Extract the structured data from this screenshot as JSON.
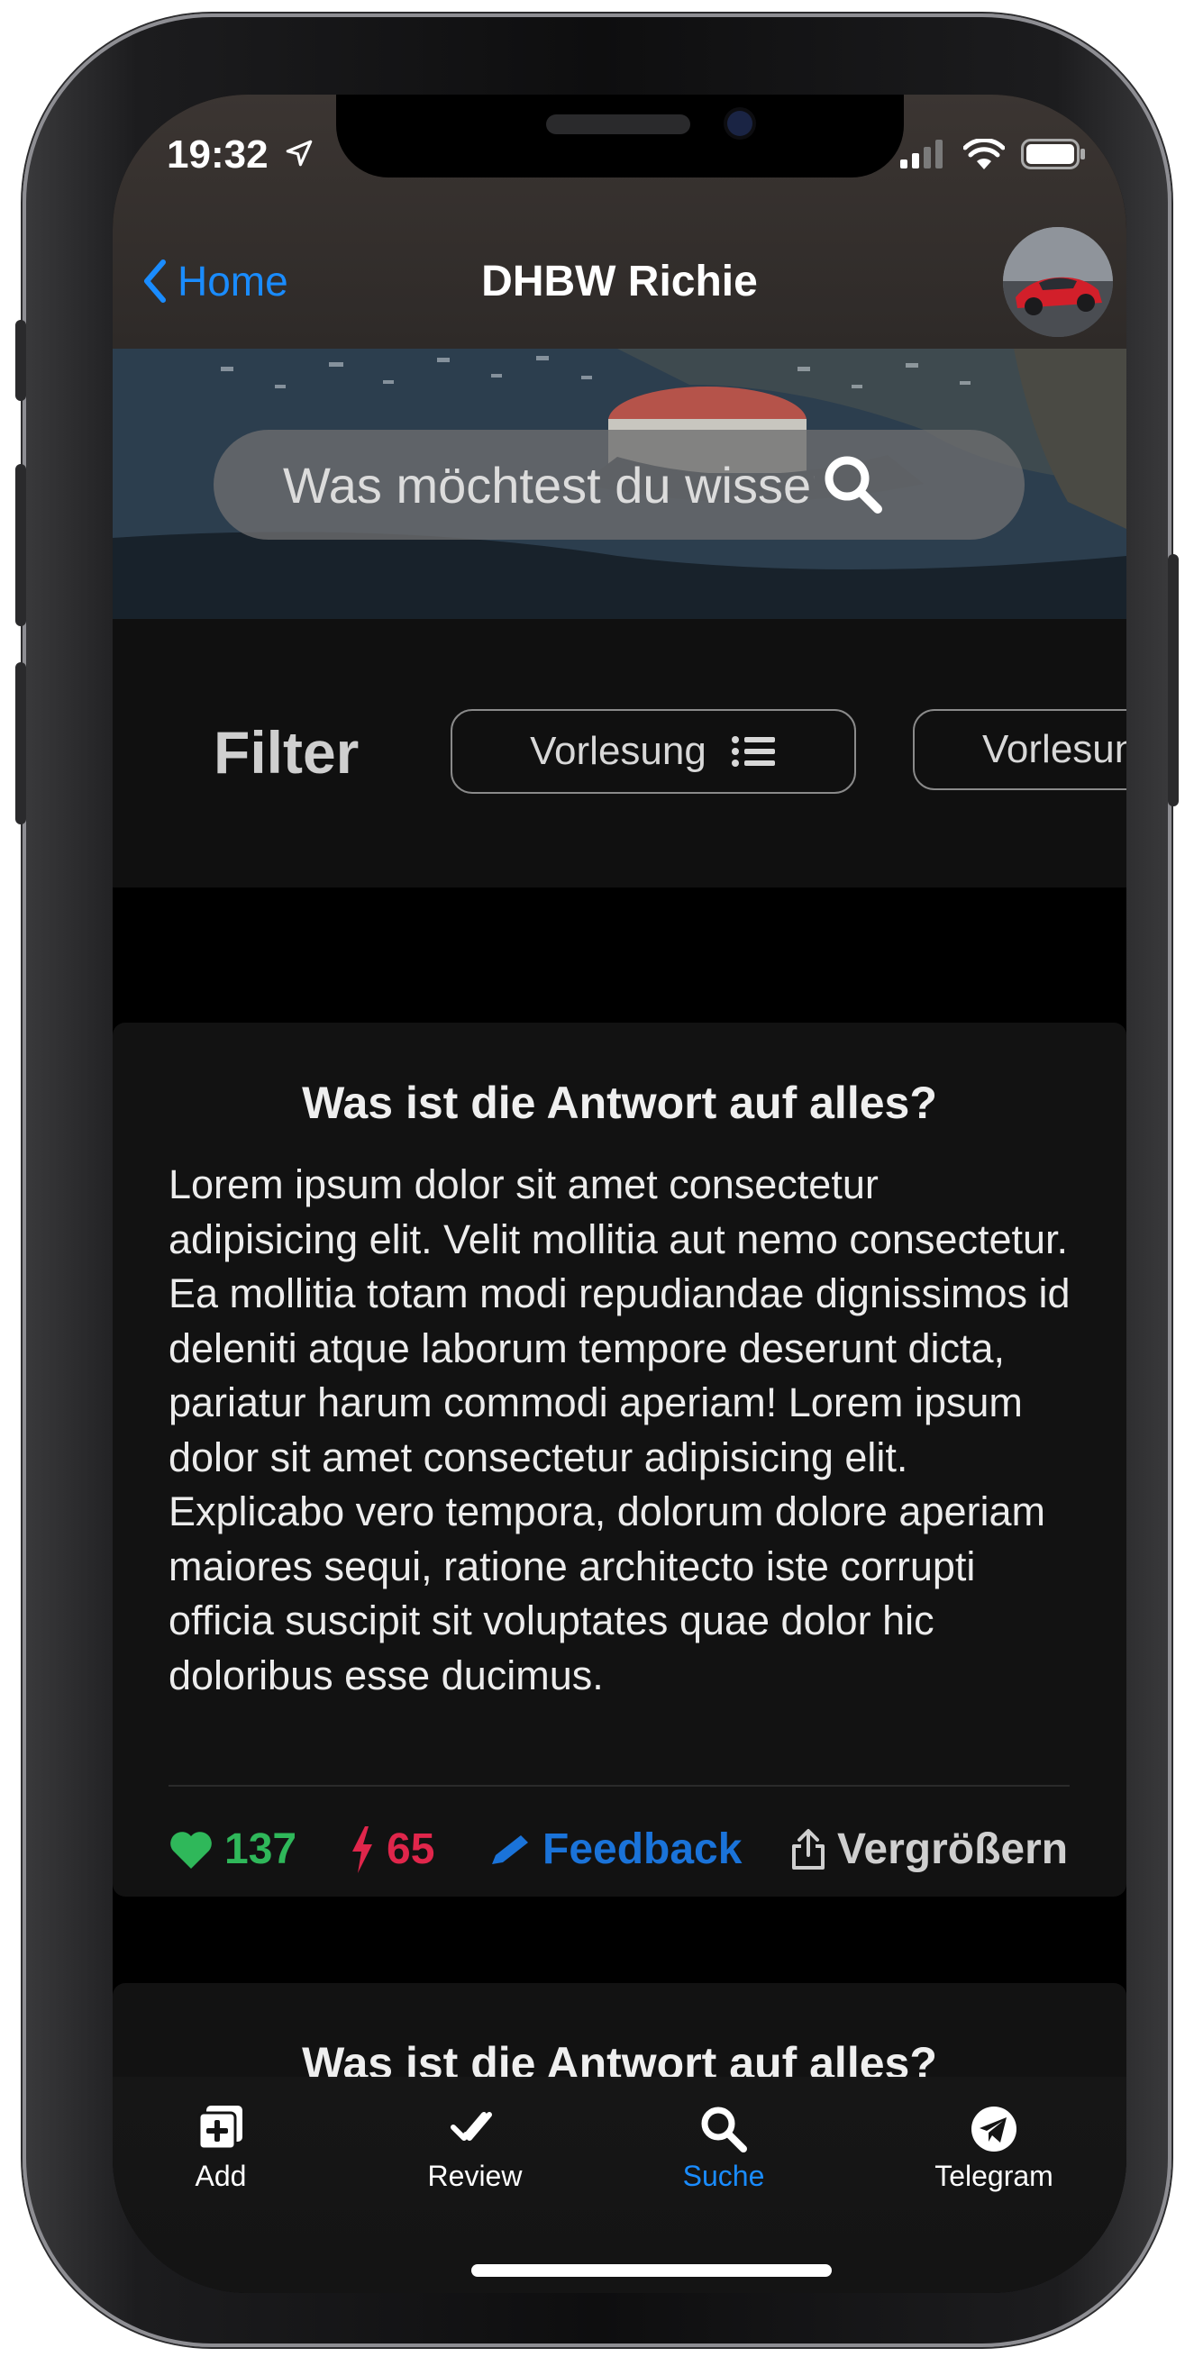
{
  "status": {
    "time": "19:32"
  },
  "nav": {
    "back_label": "Home",
    "title": "DHBW Richie"
  },
  "search": {
    "placeholder": "Was möchtest du wissen?"
  },
  "filter": {
    "label": "Filter",
    "chips": [
      "Vorlesung",
      "Vorlesung"
    ]
  },
  "cards": [
    {
      "title": "Was ist die Antwort auf alles?",
      "body": "Lorem ipsum dolor sit amet consectetur adipisicing elit. Velit mollitia aut nemo consectetur. Ea mollitia totam modi repudiandae dignissimos id deleniti atque laborum tempore deserunt dicta, pariatur harum commodi aperiam! Lorem ipsum dolor sit amet consectetur adipisicing elit. Explicabo vero tempora, dolorum dolore aperiam maiores sequi, ratione architecto iste corrupti officia suscipit sit voluptates quae dolor hic doloribus esse ducimus.",
      "likes": "137",
      "flashes": "65",
      "feedback_label": "Feedback",
      "enlarge_label": "Vergrößern"
    },
    {
      "title": "Was ist die Antwort auf alles?"
    }
  ],
  "tabbar": {
    "items": [
      {
        "label": "Add",
        "icon": "add-square-icon"
      },
      {
        "label": "Review",
        "icon": "double-check-icon"
      },
      {
        "label": "Suche",
        "icon": "search-icon",
        "active": true
      },
      {
        "label": "Telegram",
        "icon": "telegram-icon"
      }
    ]
  },
  "colors": {
    "accent": "#1a8cff",
    "like": "#2fb85a",
    "flash": "#e0264b",
    "feedback": "#1a73d9",
    "tab_active": "#1a8cff"
  }
}
